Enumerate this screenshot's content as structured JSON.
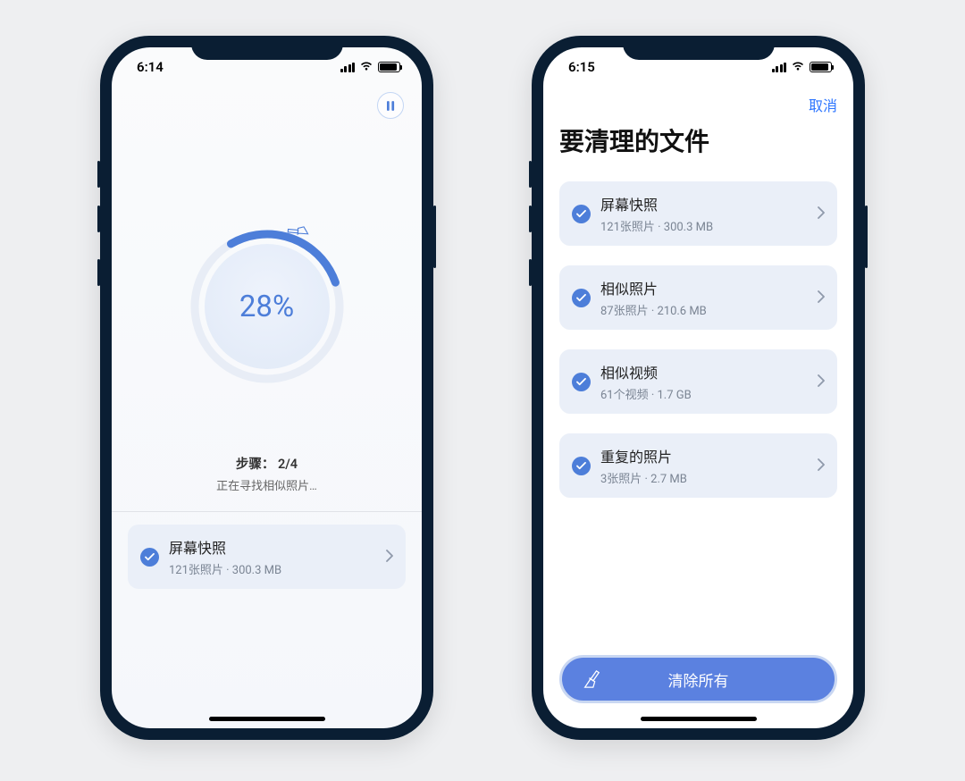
{
  "screen1": {
    "status_time": "6:14",
    "progress_percent": "28%",
    "steps_label": "步骤： 2/4",
    "steps_detail": "正在寻找相似照片…",
    "row": {
      "title": "屏幕快照",
      "subtitle": "121张照片 · 300.3 MB"
    }
  },
  "screen2": {
    "status_time": "6:15",
    "cancel": "取消",
    "heading": "要清理的文件",
    "items": [
      {
        "title": "屏幕快照",
        "subtitle": "121张照片 · 300.3 MB"
      },
      {
        "title": "相似照片",
        "subtitle": "87张照片 · 210.6 MB"
      },
      {
        "title": "相似视频",
        "subtitle": "61个视频 · 1.7 GB"
      },
      {
        "title": "重复的照片",
        "subtitle": "3张照片 · 2.7 MB"
      }
    ],
    "primary_button": "清除所有"
  }
}
